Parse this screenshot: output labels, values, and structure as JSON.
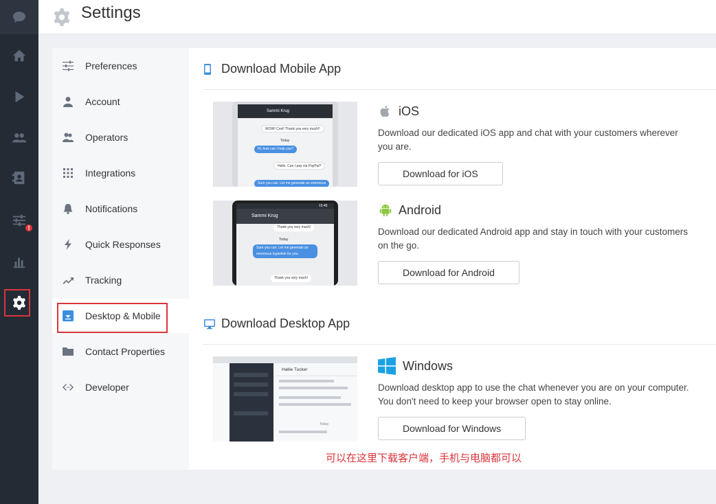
{
  "header": {
    "title": "Settings"
  },
  "nav": {
    "items": [
      {
        "label": "Preferences"
      },
      {
        "label": "Account"
      },
      {
        "label": "Operators"
      },
      {
        "label": "Integrations"
      },
      {
        "label": "Notifications"
      },
      {
        "label": "Quick Responses"
      },
      {
        "label": "Tracking"
      },
      {
        "label": "Desktop & Mobile"
      },
      {
        "label": "Contact Properties"
      },
      {
        "label": "Developer"
      }
    ],
    "active": "Desktop & Mobile"
  },
  "mobile": {
    "title": "Download Mobile App",
    "ios": {
      "name": "iOS",
      "description": "Download our dedicated iOS app and chat with your customers wherever you are.",
      "button": "Download for iOS",
      "shot": {
        "contact": "Sammi Krug",
        "msg1": "WOW! Cool! Thank you very much!!",
        "day": "Today",
        "msg2": "Hi, how can I help you?",
        "msg3": "Hello. Can I pay via PayPal?",
        "msg4": "Sure you can. Let me generate an enormous"
      }
    },
    "android": {
      "name": "Android",
      "description": "Download our dedicated Android app and stay in touch with your customers on the go.",
      "button": "Download for Android",
      "shot": {
        "contact": "Sammi Krug",
        "msg1": "Thank you very much!",
        "day": "Today",
        "msg2": "Sure you can. Let me generate an enormous hyperlink for you.",
        "msg3": "Thank you very much!",
        "time": "15:45"
      }
    }
  },
  "desktop": {
    "title": "Download Desktop App",
    "windows": {
      "name": "Windows",
      "description": "Download desktop app to use the chat whenever you are on your computer. You don't need to keep your browser open to stay online.",
      "button": "Download for Windows",
      "shot": {
        "contact": "Hallie Tucker",
        "day": "Today"
      }
    }
  },
  "annotation": "可以在这里下载客户端，手机与电脑都可以",
  "rail": {
    "alert_badge": "!"
  },
  "colors": {
    "rail_bg": "#252b35",
    "accent": "#3c8fdc",
    "highlight": "#d9343a",
    "android": "#8cc63f",
    "windows": "#1ba1e2"
  }
}
